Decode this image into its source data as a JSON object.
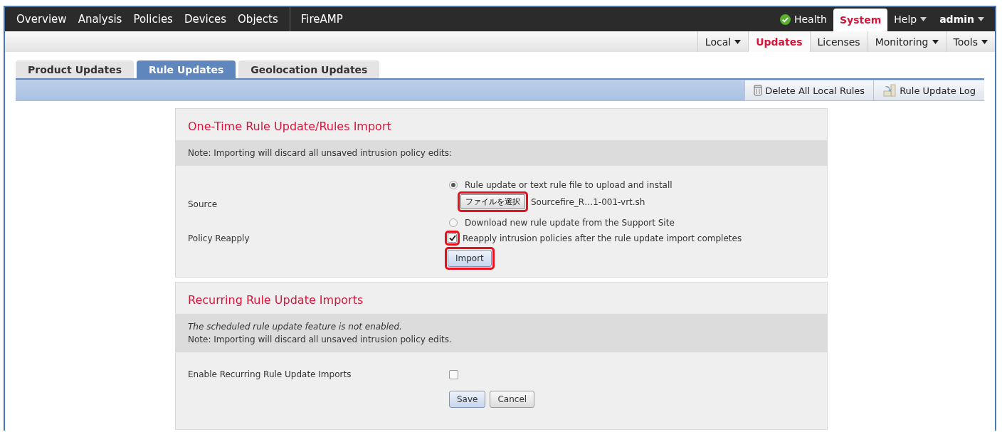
{
  "top_nav": {
    "main_items": [
      {
        "label": "Overview"
      },
      {
        "label": "Analysis"
      },
      {
        "label": "Policies"
      },
      {
        "label": "Devices"
      },
      {
        "label": "Objects"
      }
    ],
    "app_items": [
      {
        "label": "FireAMP"
      }
    ],
    "right_items": [
      {
        "label": "Health",
        "kind": "health",
        "selected": false,
        "dropdown": false
      },
      {
        "label": "System",
        "kind": "plain",
        "selected": true,
        "dropdown": false
      },
      {
        "label": "Help",
        "kind": "plain",
        "selected": false,
        "dropdown": true
      },
      {
        "label": "admin",
        "kind": "user",
        "selected": false,
        "dropdown": true
      }
    ]
  },
  "sub_nav": [
    {
      "label": "Local",
      "selected": false,
      "dropdown": true
    },
    {
      "label": "Updates",
      "selected": true,
      "dropdown": false
    },
    {
      "label": "Licenses",
      "selected": false,
      "dropdown": false
    },
    {
      "label": "Monitoring",
      "selected": false,
      "dropdown": true
    },
    {
      "label": "Tools",
      "selected": false,
      "dropdown": true
    }
  ],
  "tabs": [
    {
      "label": "Product Updates",
      "selected": false
    },
    {
      "label": "Rule Updates",
      "selected": true
    },
    {
      "label": "Geolocation Updates",
      "selected": false
    }
  ],
  "toolbar": [
    {
      "label": "Delete All Local Rules",
      "kind": "delete"
    },
    {
      "label": "Rule Update Log",
      "kind": "log"
    }
  ],
  "import_panel": {
    "title": "One-Time Rule Update/Rules Import",
    "note": "Note: Importing will discard all unsaved intrusion policy edits:",
    "source_label": "Source",
    "source_options": [
      {
        "label": "Rule update or text rule file to upload and install",
        "selected": true,
        "file_button": {
          "label": "ファイルを選択",
          "highlighted": true
        },
        "file_name": "Sourcefire_R…1-001-vrt.sh"
      },
      {
        "label": "Download new rule update from the Support Site",
        "selected": false
      }
    ],
    "policy_reapply": {
      "label": "Policy Reapply",
      "text": "Reapply intrusion policies after the rule update import completes",
      "checked": true,
      "highlighted": true
    },
    "import_button": {
      "label": "Import",
      "highlighted": true
    }
  },
  "recurring_panel": {
    "title": "Recurring Rule Update Imports",
    "notes": [
      {
        "text": "The scheduled rule update feature is not enabled.",
        "italic": true
      },
      {
        "text": "Note: Importing will discard all unsaved intrusion policy edits.",
        "italic": false
      }
    ],
    "enable": {
      "label": "Enable Recurring Rule Update Imports",
      "checked": false
    },
    "buttons": [
      {
        "label": "Save",
        "kind": "primary"
      },
      {
        "label": "Cancel",
        "kind": "secondary"
      }
    ]
  }
}
